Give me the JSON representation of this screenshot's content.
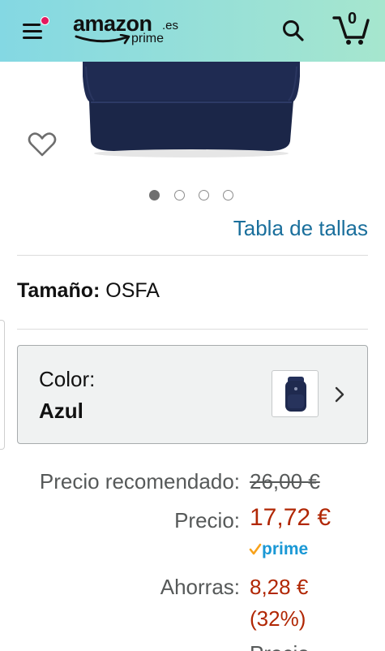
{
  "header": {
    "logo_text": "amazon",
    "logo_tld": ".es",
    "logo_prime": "prime",
    "cart_count": "0",
    "notification_color": "#e3185e",
    "icons": {
      "menu": "menu-icon",
      "search": "search-icon",
      "cart": "cart-icon"
    }
  },
  "gallery": {
    "image_count": 4,
    "active_index": 0,
    "wishlist_icon": "heart-icon"
  },
  "size_chart_link": "Tabla de tallas",
  "size": {
    "label": "Tamaño:",
    "value": "OSFA"
  },
  "color": {
    "label": "Color:",
    "value": "Azul",
    "swatch_color": "#1f2a4f"
  },
  "prices": {
    "list_label": "Precio recomendado:",
    "list_value": "26,00 €",
    "price_label": "Precio:",
    "price_value": "17,72 €",
    "prime_label": "prime",
    "save_label": "Ahorras:",
    "save_value": "8,28 €",
    "save_percent": "(32%)",
    "next_label_partial": "Precio"
  },
  "colors": {
    "accent_link": "#1a6f9c",
    "price_red": "#b12704",
    "prime_blue": "#1a98d5"
  }
}
